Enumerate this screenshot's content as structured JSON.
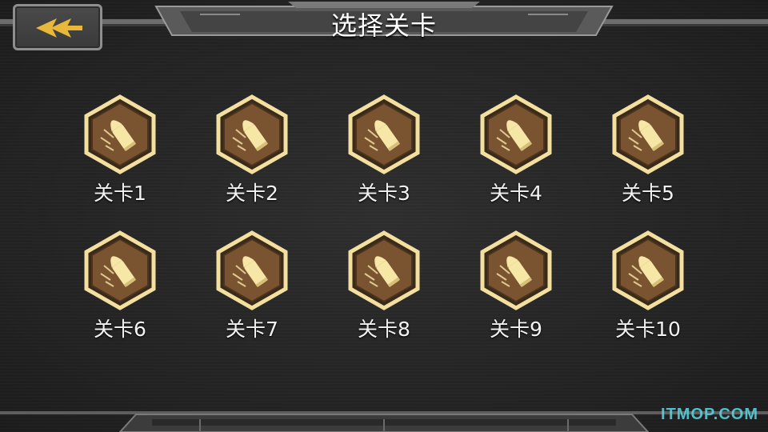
{
  "header": {
    "title": "选择关卡",
    "back_icon": "double-chevron-left-icon"
  },
  "levels": [
    {
      "label": "关卡1",
      "icon": "bullet-icon"
    },
    {
      "label": "关卡2",
      "icon": "bullet-icon"
    },
    {
      "label": "关卡3",
      "icon": "bullet-icon"
    },
    {
      "label": "关卡4",
      "icon": "bullet-icon"
    },
    {
      "label": "关卡5",
      "icon": "bullet-icon"
    },
    {
      "label": "关卡6",
      "icon": "bullet-icon"
    },
    {
      "label": "关卡7",
      "icon": "bullet-icon"
    },
    {
      "label": "关卡8",
      "icon": "bullet-icon"
    },
    {
      "label": "关卡9",
      "icon": "bullet-icon"
    },
    {
      "label": "关卡10",
      "icon": "bullet-icon"
    }
  ],
  "watermark": "ITMOP.COM",
  "colors": {
    "badge_fill": "#7a5430",
    "badge_border": "#f3e0a0",
    "bullet": "#f7e7a6",
    "arrow": "#e8b83a",
    "watermark": "#57d9e8"
  }
}
